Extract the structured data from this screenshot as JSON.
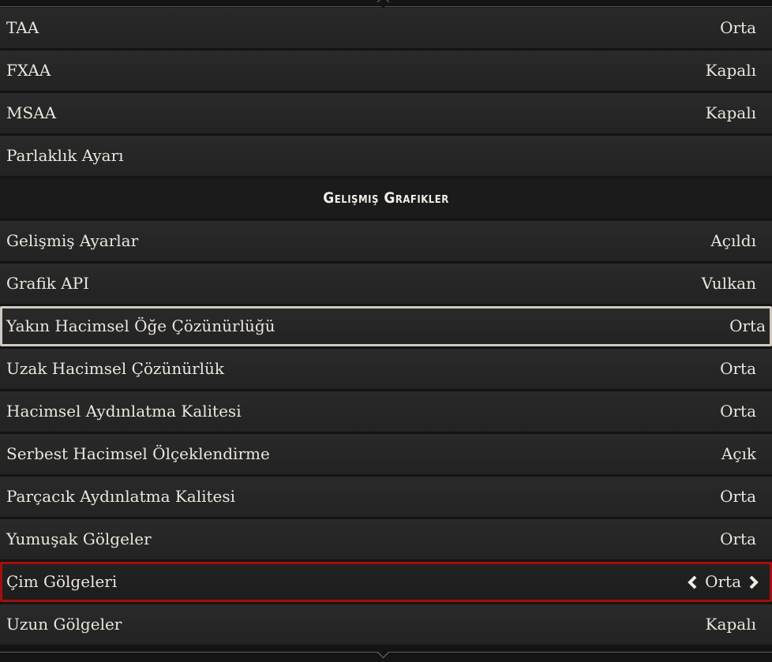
{
  "rows_top": [
    {
      "label": "TAA",
      "value": "Orta"
    },
    {
      "label": "FXAA",
      "value": "Kapalı"
    },
    {
      "label": "MSAA",
      "value": "Kapalı"
    },
    {
      "label": "Parlaklık Ayarı",
      "value": ""
    }
  ],
  "section": {
    "title": "Gelişmiş Grafikler"
  },
  "rows_adv": [
    {
      "label": "Gelişmiş Ayarlar",
      "value": "Açıldı"
    },
    {
      "label": "Grafik API",
      "value": "Vulkan"
    },
    {
      "label": "Yakın Hacimsel Öğe Çözünürlüğü",
      "value": "Orta"
    },
    {
      "label": "Uzak Hacimsel Çözünürlük",
      "value": "Orta"
    },
    {
      "label": "Hacimsel Aydınlatma Kalitesi",
      "value": "Orta"
    },
    {
      "label": "Serbest Hacimsel Ölçeklendirme",
      "value": "Açık"
    },
    {
      "label": "Parçacık Aydınlatma Kalitesi",
      "value": "Orta"
    },
    {
      "label": "Yumuşak Gölgeler",
      "value": "Orta"
    },
    {
      "label": "Çim Gölgeleri",
      "value": "Orta"
    },
    {
      "label": "Uzun Gölgeler",
      "value": "Kapalı"
    }
  ],
  "icons": {
    "prev": "chevron-left-icon",
    "next": "chevron-right-icon"
  },
  "colors": {
    "selected_border": "#a60d0d",
    "hover_border": "#cfcac0"
  }
}
